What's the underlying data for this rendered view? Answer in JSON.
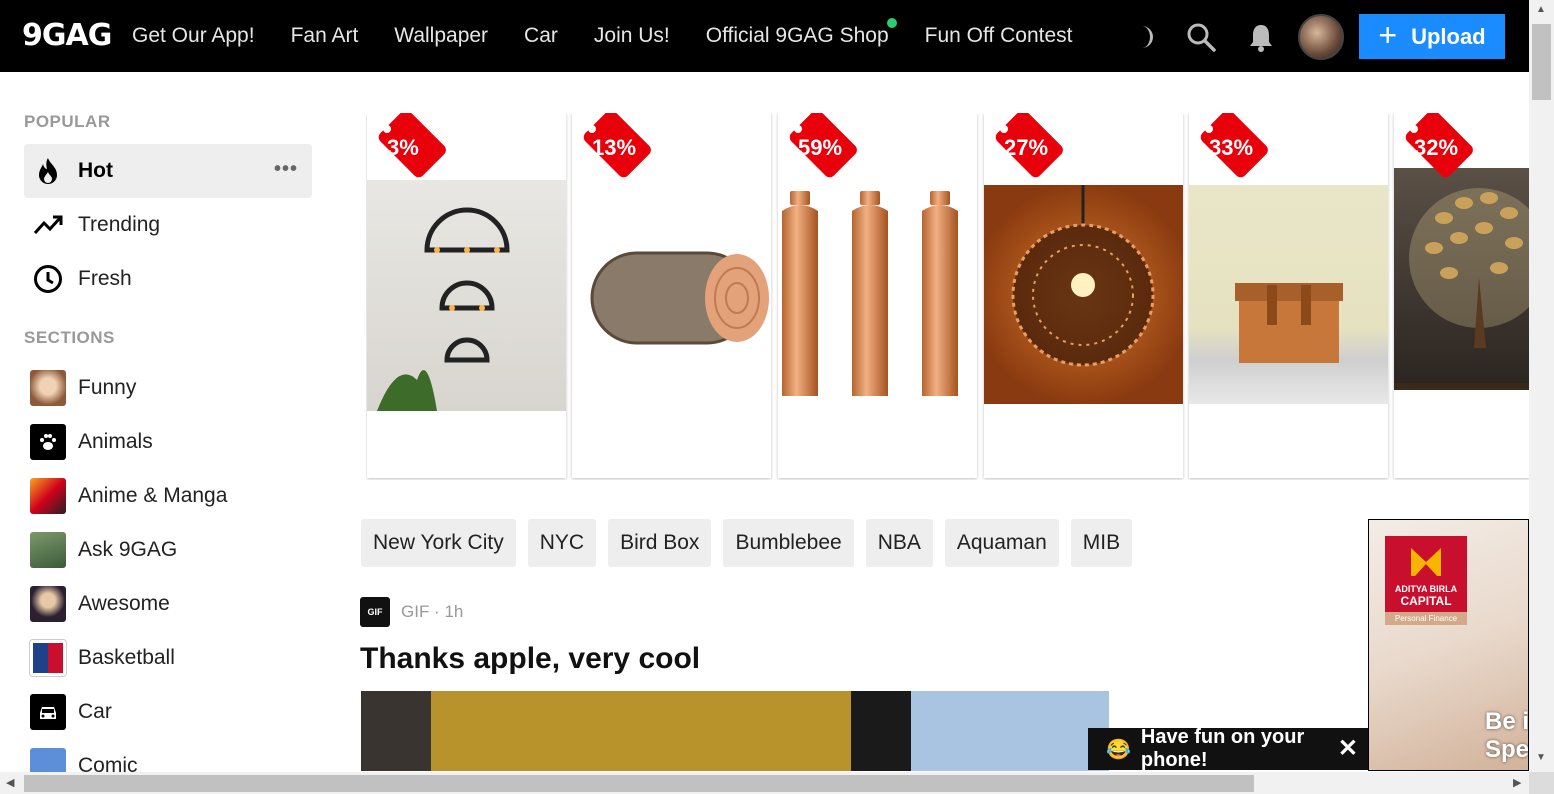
{
  "header": {
    "logo": "9GAG",
    "nav": [
      "Get Our App!",
      "Fan Art",
      "Wallpaper",
      "Car",
      "Join Us!",
      "Official 9GAG Shop",
      "Fun Off Contest"
    ],
    "upload_label": "Upload",
    "icons": [
      "moon-icon",
      "search-icon",
      "bell-icon",
      "avatar"
    ]
  },
  "sidebar": {
    "popular_title": "POPULAR",
    "popular": [
      {
        "label": "Hot",
        "icon": "fire-icon",
        "active": true
      },
      {
        "label": "Trending",
        "icon": "trending-icon"
      },
      {
        "label": "Fresh",
        "icon": "clock-icon"
      }
    ],
    "more_label": "•••",
    "sections_title": "SECTIONS",
    "sections": [
      {
        "label": "Funny",
        "icon": "funny-thumb"
      },
      {
        "label": "Animals",
        "icon": "paw-icon"
      },
      {
        "label": "Anime & Manga",
        "icon": "anime-thumb"
      },
      {
        "label": "Ask 9GAG",
        "icon": "ask-thumb"
      },
      {
        "label": "Awesome",
        "icon": "awesome-thumb"
      },
      {
        "label": "Basketball",
        "icon": "nba-icon"
      },
      {
        "label": "Car",
        "icon": "car-icon"
      },
      {
        "label": "Comic",
        "icon": "cloud-icon"
      }
    ]
  },
  "products": [
    {
      "discount": "3%"
    },
    {
      "discount": "13%"
    },
    {
      "discount": "59%"
    },
    {
      "discount": "27%"
    },
    {
      "discount": "33%"
    },
    {
      "discount": "32%"
    }
  ],
  "tags": [
    "New York City",
    "NYC",
    "Bird Box",
    "Bumblebee",
    "NBA",
    "Aquaman",
    "MIB"
  ],
  "post": {
    "type_badge": "GIF",
    "meta": "GIF · 1h",
    "title": "Thanks apple, very cool"
  },
  "ad": {
    "logo_line1": "ADITYA BIRLA",
    "logo_line2": "CAPITAL",
    "logo_line3": "Personal Finance",
    "text_line1": "Be i",
    "text_line2": "Spe"
  },
  "toast": {
    "emoji": "😂",
    "text": "Have fun on your phone!",
    "close": "✕"
  },
  "colors": {
    "header_bg": "#000000",
    "upload": "#1a8cff",
    "badge": "#e8000b",
    "shop_dot": "#2ecc71"
  }
}
